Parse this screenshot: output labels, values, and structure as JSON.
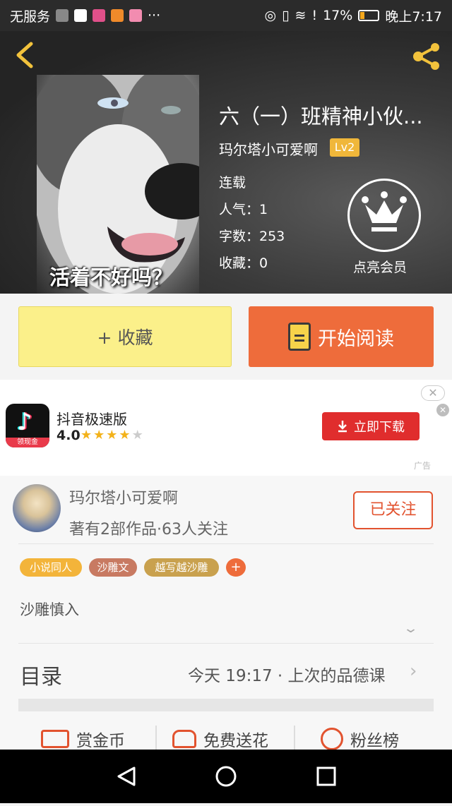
{
  "status_bar": {
    "carrier": "无服务",
    "dots": "···",
    "battery_pct": "17%",
    "time": "晚上7:17"
  },
  "header": {
    "back_icon": "back-chevron-icon",
    "share_icon": "share-icon",
    "cover_caption": "活着不好吗？",
    "title": "六（一）班精神小伙...",
    "author": "玛尔塔小可爱啊",
    "level": "Lv2",
    "status": "连载",
    "popularity": "人气：1",
    "word_count": "字数：253",
    "favorites": "收藏：0",
    "vip_label": "点亮会员"
  },
  "actions": {
    "favorite": "+ 收藏",
    "read": "开始阅读"
  },
  "ad": {
    "close": "✕",
    "app_name": "抖音极速版",
    "rating": "4.0",
    "stars": 4,
    "icon_tag": "领现金",
    "download": "立即下载",
    "label": "广告"
  },
  "author_section": {
    "name": "玛尔塔小可爱啊",
    "stats": "著有2部作品·63人关注",
    "follow_button": "已关注",
    "tags": [
      "小说同人",
      "沙雕文",
      "越写越沙雕"
    ],
    "tag_add": "+",
    "intro": "沙雕慎入"
  },
  "toc": {
    "title": "目录",
    "latest": "今天 19:17 · 上次的品德课"
  },
  "bottom_actions": [
    "赏金币",
    "免费送花",
    "粉丝榜"
  ],
  "colors": {
    "accent_orange": "#ee6c3b",
    "fav_yellow": "#fbf08a",
    "gold": "#f2c23c",
    "ad_red": "#e02d2d"
  }
}
